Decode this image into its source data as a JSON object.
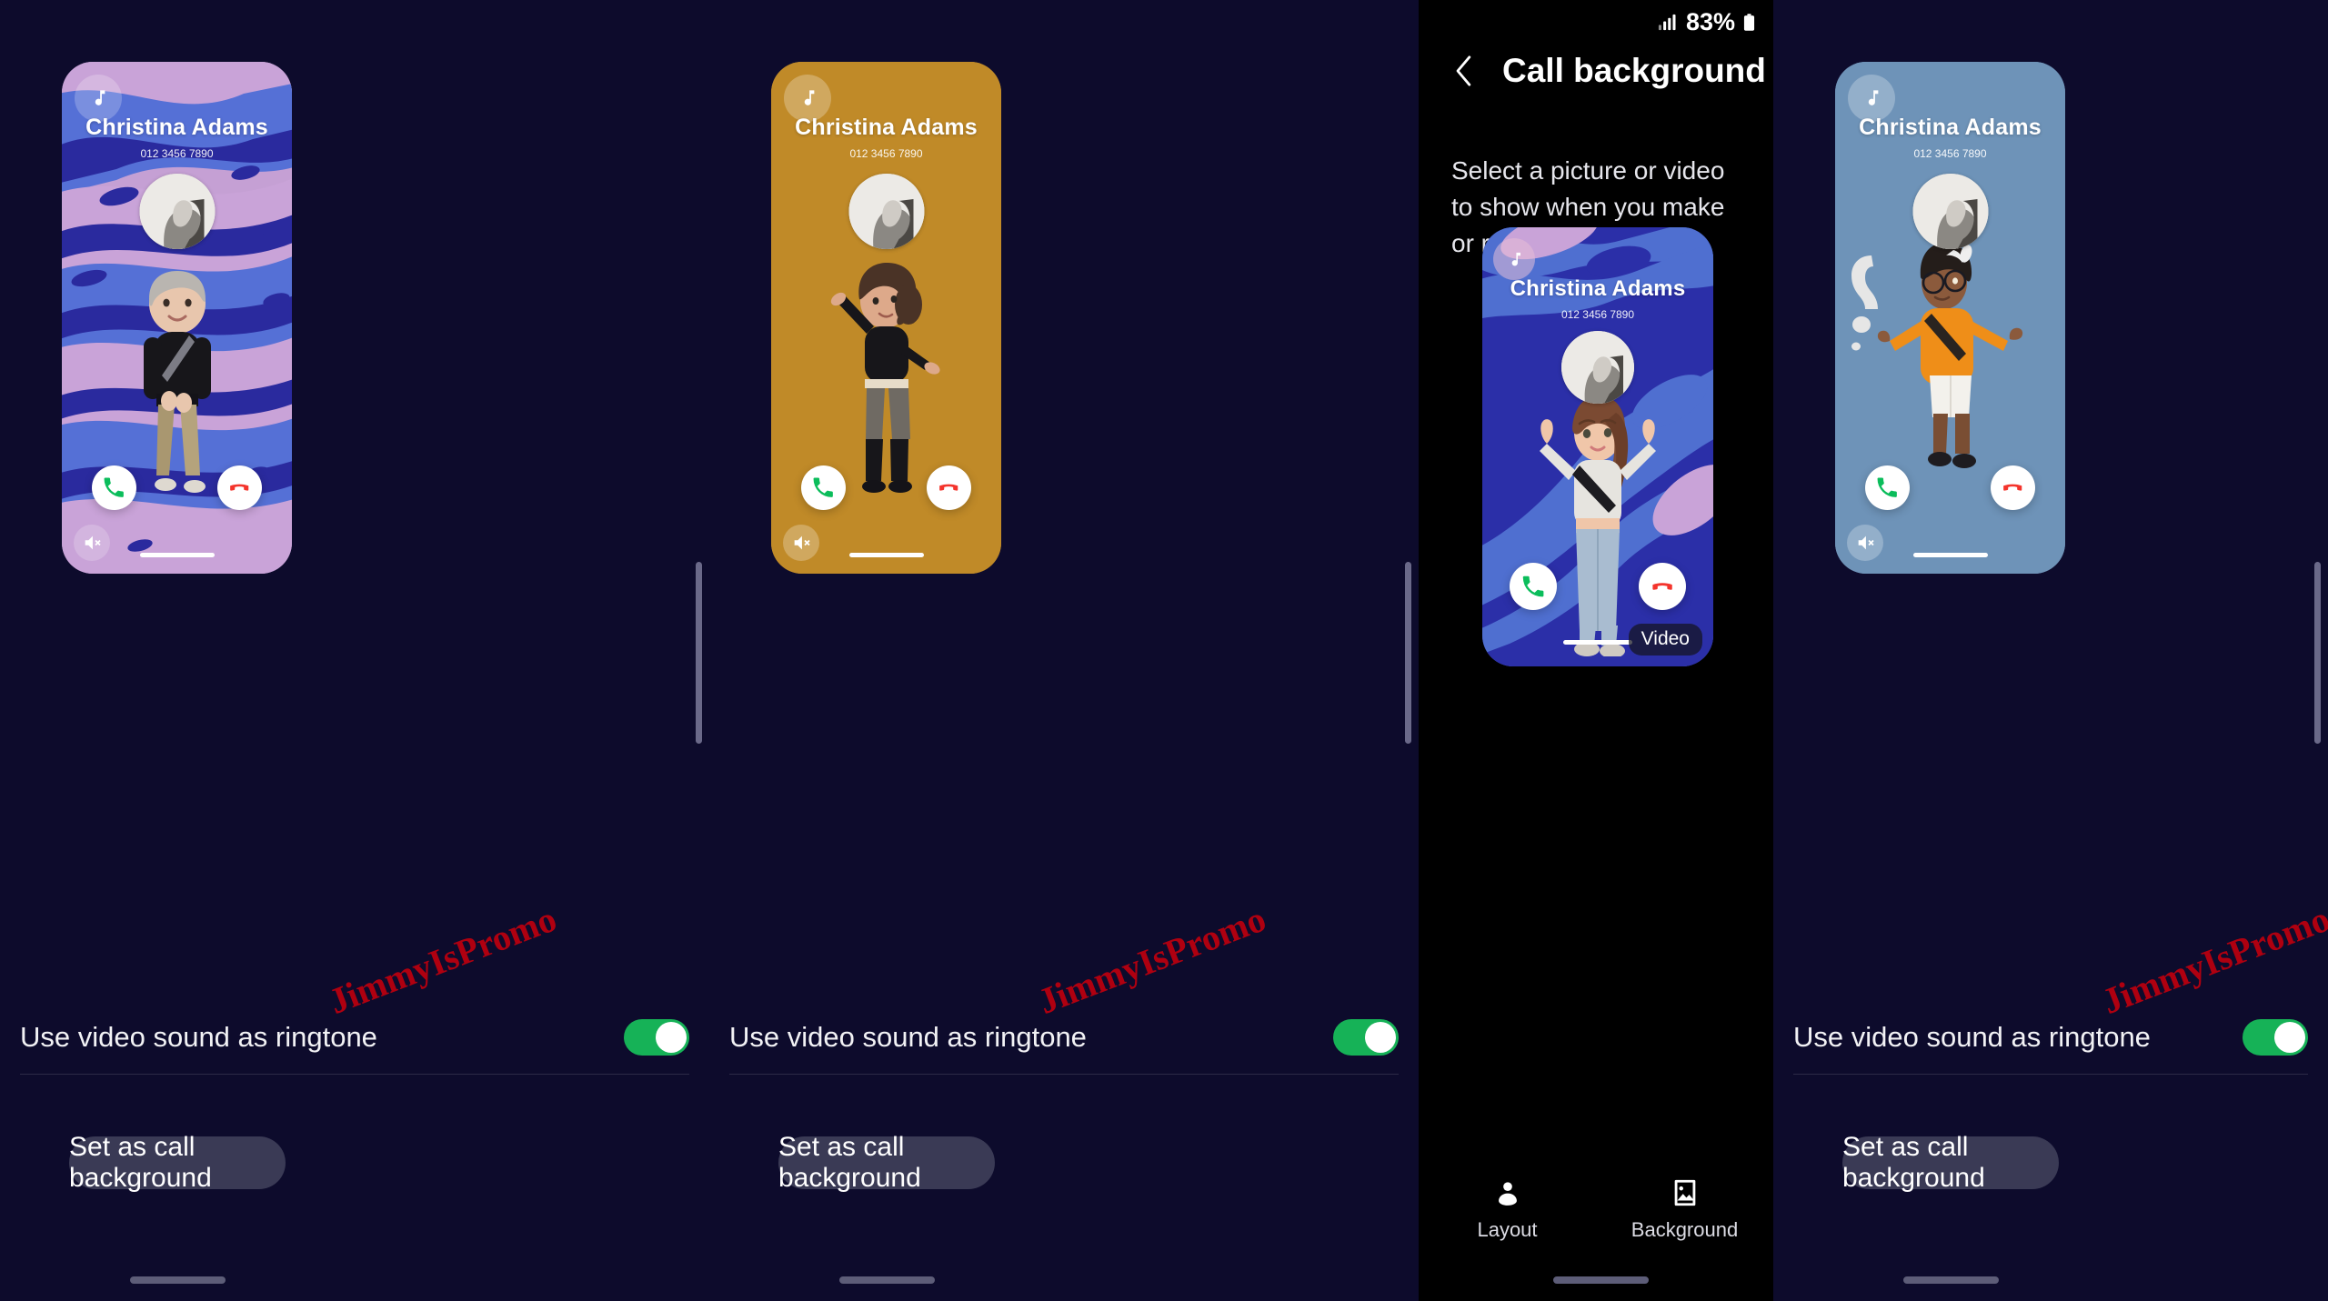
{
  "status_bar": {
    "battery_percent": "83%",
    "signal_icon": "signal-bars-icon",
    "battery_icon": "battery-icon"
  },
  "app_bar": {
    "back_icon": "back-arrow-icon",
    "title": "Call background"
  },
  "description": "Select a picture or video to show when you make or receive calls.",
  "tabs": [
    {
      "label": "Layout",
      "icon": "person-icon"
    },
    {
      "label": "Background",
      "icon": "image-icon"
    }
  ],
  "caller": {
    "name": "Christina Adams",
    "number": "012 3456 7890"
  },
  "badges": {
    "music_icon": "music-note-icon",
    "mute_icon": "speaker-mute-icon",
    "answer_icon": "phone-answer-icon",
    "decline_icon": "phone-decline-icon",
    "video_label": "Video"
  },
  "setting": {
    "label": "Use video sound as ringtone",
    "toggle_state": "on",
    "toggle_color": "#16b257"
  },
  "cta": {
    "label": "Set as call background"
  },
  "watermark": {
    "text": "JimmyIsPromo",
    "color": "#b8000f"
  },
  "panels": [
    {
      "id": "panel-1",
      "theme": "abstract-pink-blue",
      "accent": "#5570d6"
    },
    {
      "id": "panel-2",
      "theme": "solid-gold",
      "accent": "#c08a28"
    },
    {
      "id": "panel-3",
      "theme": "editor-preview-blue",
      "accent": "#2b2fa8"
    },
    {
      "id": "panel-4",
      "theme": "solid-steel-blue",
      "accent": "#6e93b8"
    }
  ]
}
